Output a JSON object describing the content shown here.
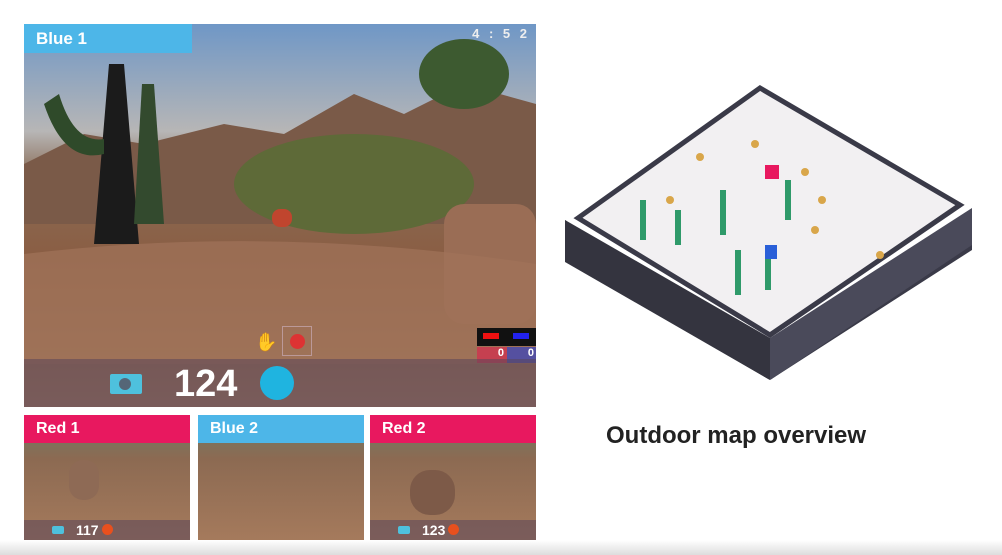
{
  "colors": {
    "blue": "#4db6e8",
    "red": "#e8185f",
    "hud_accent": "#4ec1dd",
    "ammo_orange": "#e8501e"
  },
  "main_view": {
    "player": "Blue 1",
    "timer": "4 : 5 2",
    "ammo": "124",
    "score_red": "0",
    "score_blue": "0",
    "icons": [
      "camera-tag-icon",
      "hand-icon",
      "target-icon",
      "crosshair-circle-icon",
      "red-gun-icon",
      "blue-gun-icon"
    ]
  },
  "sub_views": [
    {
      "player": "Red 1",
      "team": "red",
      "ammo": "117"
    },
    {
      "player": "Blue 2",
      "team": "blue",
      "ammo": ""
    },
    {
      "player": "Red 2",
      "team": "red",
      "ammo": "123"
    }
  ],
  "caption": "Outdoor map overview"
}
